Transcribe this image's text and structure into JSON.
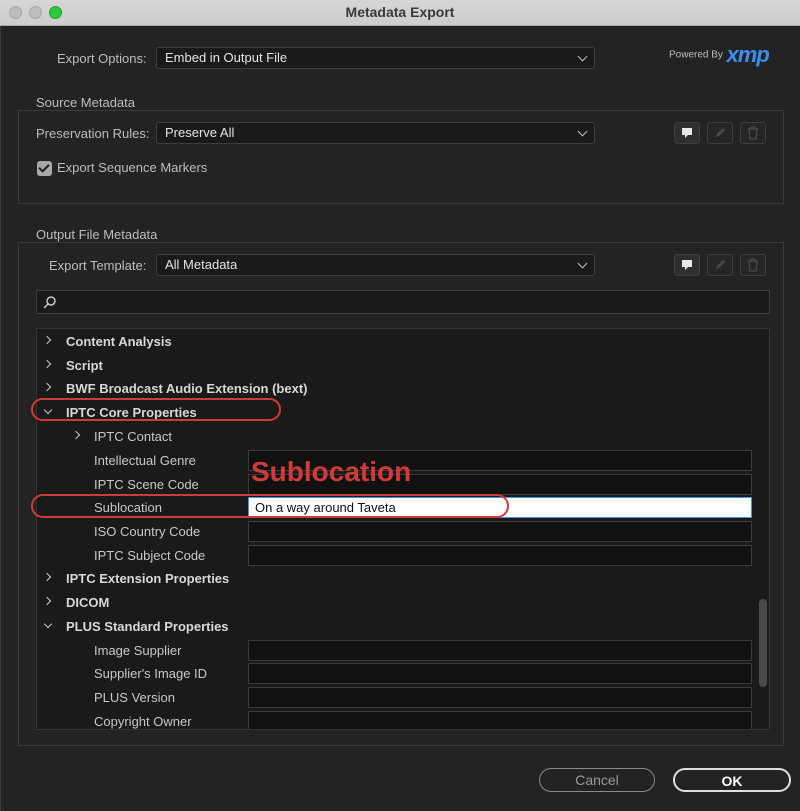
{
  "window": {
    "title": "Metadata Export"
  },
  "export_options": {
    "label": "Export Options:",
    "value": "Embed in Output File"
  },
  "branding": {
    "powered_by": "Powered By",
    "logo": "xmp",
    "logo_color": "#3a8ef0"
  },
  "source_metadata": {
    "title": "Source Metadata",
    "preservation_label": "Preservation Rules:",
    "preservation_value": "Preserve All",
    "export_markers_label": "Export Sequence Markers",
    "export_markers_checked": true
  },
  "output_metadata": {
    "title": "Output File Metadata",
    "template_label": "Export Template:",
    "template_value": "All Metadata",
    "search_placeholder": ""
  },
  "tree": {
    "groups": [
      {
        "label": "Content Analysis",
        "expanded": false
      },
      {
        "label": "Script",
        "expanded": false
      },
      {
        "label": "BWF Broadcast Audio Extension (bext)",
        "expanded": false
      },
      {
        "label": "IPTC Core Properties",
        "expanded": true
      },
      {
        "label": "IPTC Extension Properties",
        "expanded": false
      },
      {
        "label": "DICOM",
        "expanded": false
      },
      {
        "label": "PLUS Standard Properties",
        "expanded": true
      }
    ],
    "iptc_core_items": [
      {
        "label": "IPTC Contact",
        "value": ""
      },
      {
        "label": "Intellectual Genre",
        "value": ""
      },
      {
        "label": "IPTC Scene Code",
        "value": ""
      },
      {
        "label": "Sublocation",
        "value": "On a way around Taveta"
      },
      {
        "label": "ISO Country Code",
        "value": ""
      },
      {
        "label": "IPTC Subject Code",
        "value": ""
      }
    ],
    "plus_items": [
      {
        "label": "Image Supplier",
        "value": ""
      },
      {
        "label": "Supplier's Image ID",
        "value": ""
      },
      {
        "label": "PLUS Version",
        "value": ""
      },
      {
        "label": "Copyright Owner",
        "value": ""
      }
    ]
  },
  "annotation": {
    "text": "Sublocation",
    "color": "#d23a3a"
  },
  "buttons": {
    "cancel": "Cancel",
    "ok": "OK"
  },
  "icons": [
    "new-preset-icon",
    "edit-pencil-icon",
    "trash-icon",
    "search-icon",
    "chevron-down-icon",
    "checkmark-icon"
  ]
}
